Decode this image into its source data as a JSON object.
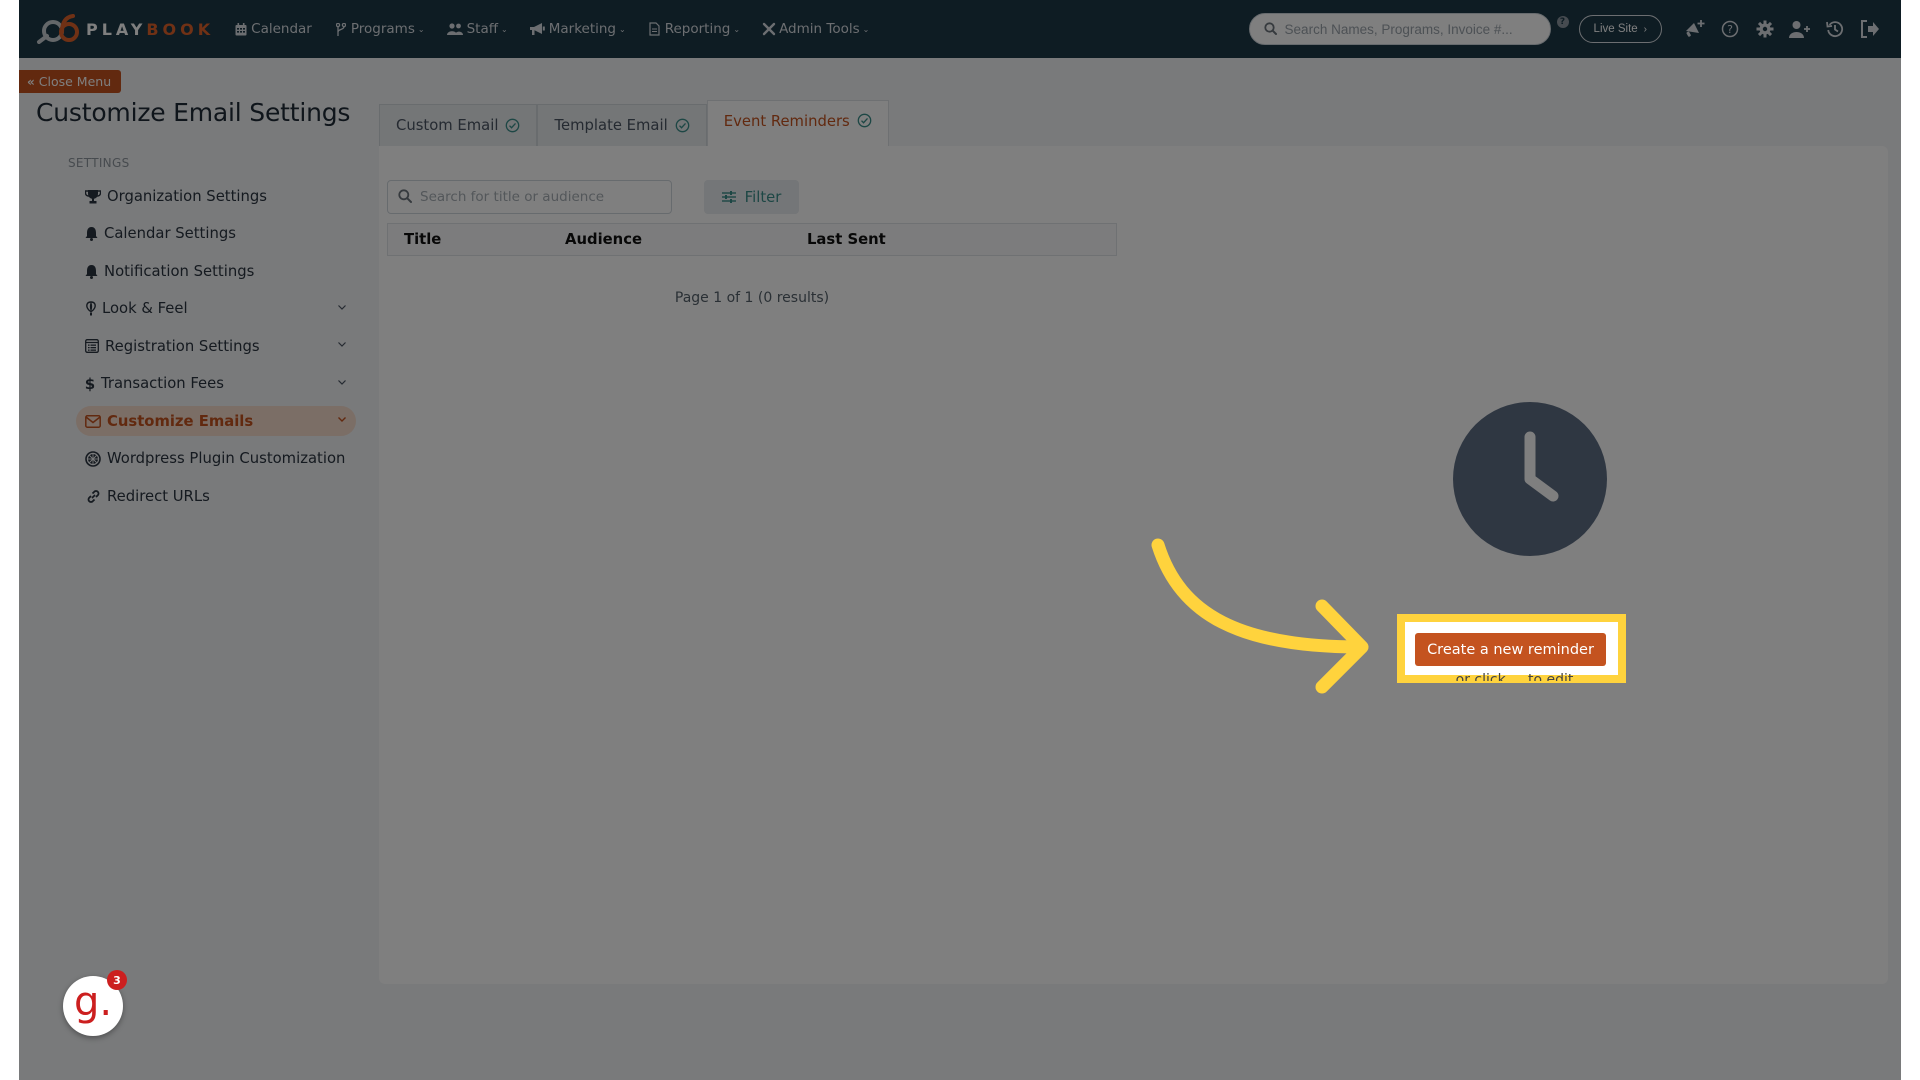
{
  "navbar": {
    "brand_play": "PLAY",
    "brand_book": "BOOK",
    "items": [
      {
        "label": "Calendar",
        "icon": "calendar-icon",
        "has_caret": false
      },
      {
        "label": "Programs",
        "icon": "code-branch-icon",
        "has_caret": true
      },
      {
        "label": "Staff",
        "icon": "users-icon",
        "has_caret": true
      },
      {
        "label": "Marketing",
        "icon": "megaphone-icon",
        "has_caret": true
      },
      {
        "label": "Reporting",
        "icon": "file-icon",
        "has_caret": true
      },
      {
        "label": "Admin Tools",
        "icon": "tools-icon",
        "has_caret": true
      }
    ],
    "search_placeholder": "Search Names, Programs, Invoice #...",
    "help_badge": "?",
    "live_site_label": "Live Site",
    "icons": [
      "announcement-plus-icon",
      "help-circle-icon",
      "gear-icon",
      "add-user-icon",
      "history-icon",
      "logout-icon"
    ]
  },
  "sidebar": {
    "close_menu_label": "Close Menu",
    "page_title": "Customize Email Settings",
    "section_label": "SETTINGS",
    "items": [
      {
        "label": "Organization Settings",
        "icon": "trophy-icon",
        "expandable": false,
        "active": false
      },
      {
        "label": "Calendar Settings",
        "icon": "bell-icon",
        "expandable": false,
        "active": false
      },
      {
        "label": "Notification Settings",
        "icon": "bell-icon",
        "expandable": false,
        "active": false
      },
      {
        "label": "Look & Feel",
        "icon": "balloon-icon",
        "expandable": true,
        "active": false
      },
      {
        "label": "Registration Settings",
        "icon": "form-icon",
        "expandable": true,
        "active": false
      },
      {
        "label": "Transaction Fees",
        "icon": "dollar-icon",
        "expandable": true,
        "active": false
      },
      {
        "label": "Customize Emails",
        "icon": "envelope-icon",
        "expandable": true,
        "active": true
      },
      {
        "label": "Wordpress Plugin Customization",
        "icon": "wordpress-icon",
        "expandable": false,
        "active": false
      },
      {
        "label": "Redirect URLs",
        "icon": "link-icon",
        "expandable": false,
        "active": false
      }
    ]
  },
  "main": {
    "tabs": [
      {
        "label": "Custom Email",
        "active": false
      },
      {
        "label": "Template Email",
        "active": false
      },
      {
        "label": "Event Reminders",
        "active": true
      }
    ],
    "search_placeholder": "Search for title or audience",
    "filter_label": "Filter",
    "table": {
      "columns": [
        "Title",
        "Audience",
        "Last Sent"
      ],
      "rows": []
    },
    "pagination": "Page 1 of 1 (0 results)",
    "empty_state": {
      "icon": "clock-icon",
      "create_button_label": "Create a new reminder",
      "secondary_text": "or click ... to edit"
    }
  },
  "chat_widget": {
    "letter": "g.",
    "badge_count": "3"
  },
  "colors": {
    "navbar_bg": "#1c3847",
    "accent": "#c4531f",
    "highlight": "#ffd33d",
    "teal": "#3b8e8a"
  }
}
